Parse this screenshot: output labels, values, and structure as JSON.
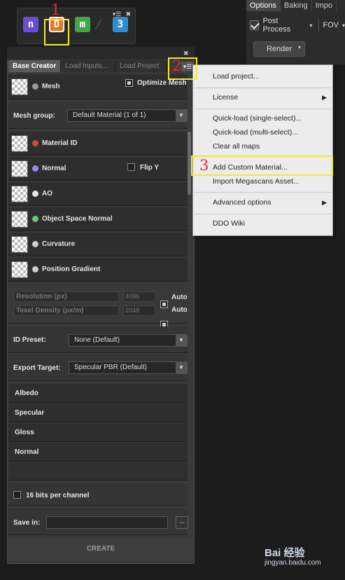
{
  "toolbar": {
    "controls": [
      "▾☰",
      "✖"
    ],
    "icons": [
      {
        "name": "ndo-icon",
        "glyph": "n",
        "color": "#6a4dd6"
      },
      {
        "name": "ddo-icon",
        "glyph": "D",
        "color": "#e8752a"
      },
      {
        "name": "mdo-icon",
        "glyph": "m",
        "color": "#3fa84a"
      },
      {
        "name": "three-d-icon",
        "glyph": "3",
        "color": "#2d8ed6"
      }
    ]
  },
  "right_panel": {
    "tabs": [
      "Options",
      "Baking",
      "Impo"
    ],
    "post_process": "Post Process",
    "post_process_arrow": "▾",
    "fov": "FOV",
    "fov_arrow": "▾",
    "render": "Render",
    "render_arrow": "▾"
  },
  "panel": {
    "close": "✖",
    "tabs": [
      "Base Creator",
      "Load Inputs...",
      "Load Project"
    ],
    "menu_glyph": "▾☰",
    "mesh_label": "Mesh",
    "optimize_mesh": "Optimize Mesh",
    "mesh_group_label": "Mesh group:",
    "mesh_group_value": "Default Material (1 of 1)",
    "maps": [
      {
        "label": "Material ID",
        "dot": "#d9463a"
      },
      {
        "label": "Normal",
        "dot": "#9a88f0"
      },
      {
        "label": "AO",
        "dot": "#e6e6e6"
      },
      {
        "label": "Object Space Normal",
        "dot": "#6ac96a"
      },
      {
        "label": "Curvature",
        "dot": "#cfcfcf"
      },
      {
        "label": "Position Gradient",
        "dot": "#cfcfcf"
      }
    ],
    "flip_y": "Flip Y",
    "resolution_label": "Resolution (px)",
    "resolution_value": "4096",
    "texel_label": "Texel Density (px/m)",
    "texel_value": "2048",
    "auto": "Auto",
    "id_preset_label": "ID Preset:",
    "id_preset_value": "None (Default)",
    "export_target_label": "Export Target:",
    "export_target_value": "Specular PBR (Default)",
    "outputs": [
      "Albedo",
      "Specular",
      "Gloss",
      "Normal"
    ],
    "bits": "16 bits per channel",
    "save_in": "Save in:",
    "browse": "...",
    "create": "CREATE"
  },
  "menu": {
    "items": [
      {
        "label": "Load project...",
        "submenu": false
      },
      {
        "label": "License",
        "submenu": true
      },
      {
        "label": "Quick-load (single-select)...",
        "submenu": false
      },
      {
        "label": "Quick-load (multi-select)...",
        "submenu": false
      },
      {
        "label": "Clear all maps",
        "submenu": false
      },
      {
        "label": "Add Custom Material...",
        "submenu": false
      },
      {
        "label": "Import Megascans Asset...",
        "submenu": false
      },
      {
        "label": "Advanced options",
        "submenu": true
      },
      {
        "label": "DDO Wiki",
        "submenu": false
      }
    ],
    "submenu_glyph": "▶"
  },
  "annotations": {
    "one": "1",
    "two": "2",
    "three": "3"
  },
  "watermark": {
    "line1": "Bai 经验",
    "line2": "jingyan.baidu.com"
  }
}
